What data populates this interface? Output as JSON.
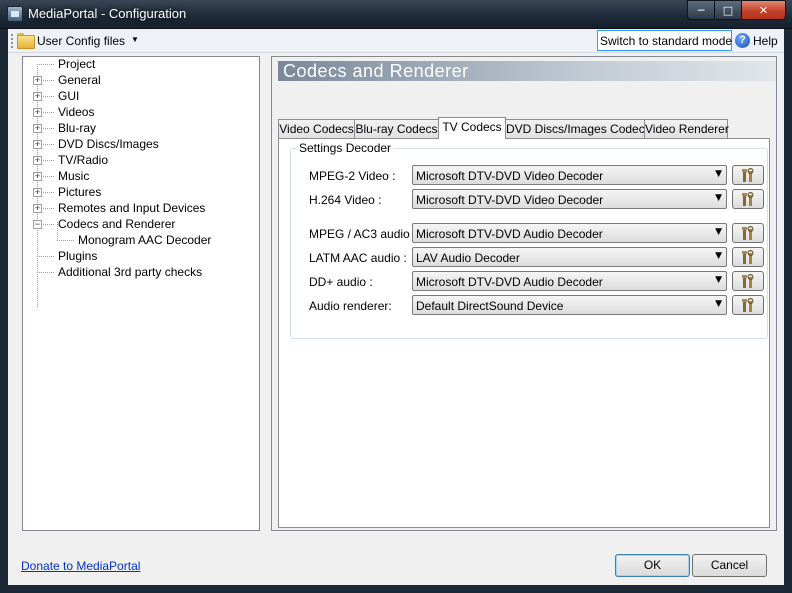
{
  "window": {
    "title": "MediaPortal - Configuration"
  },
  "toolbar": {
    "config_menu_label": "User Config files",
    "switch_label": "Switch to standard mode",
    "help_label": "Help"
  },
  "tree": {
    "items": [
      {
        "label": "Project"
      },
      {
        "label": "General"
      },
      {
        "label": "GUI"
      },
      {
        "label": "Videos"
      },
      {
        "label": "Blu-ray"
      },
      {
        "label": "DVD Discs/Images"
      },
      {
        "label": "TV/Radio"
      },
      {
        "label": "Music"
      },
      {
        "label": "Pictures"
      },
      {
        "label": "Remotes and Input Devices"
      },
      {
        "label": "Codecs and Renderer"
      },
      {
        "label": "Monogram AAC Decoder"
      },
      {
        "label": "Plugins"
      },
      {
        "label": "Additional 3rd party checks"
      }
    ]
  },
  "panel": {
    "title": "Codecs and Renderer",
    "tabs": [
      {
        "label": "Video Codecs"
      },
      {
        "label": "Blu-ray Codecs"
      },
      {
        "label": "TV Codecs"
      },
      {
        "label": "DVD Discs/Images Codecs"
      },
      {
        "label": "Video Renderer"
      }
    ],
    "group_title": "Settings Decoder",
    "rows": [
      {
        "label": "MPEG-2 Video :",
        "value": "Microsoft DTV-DVD Video Decoder"
      },
      {
        "label": "H.264 Video :",
        "value": "Microsoft DTV-DVD Video Decoder"
      },
      {
        "label": "MPEG / AC3 audio :",
        "value": "Microsoft DTV-DVD Audio Decoder"
      },
      {
        "label": "LATM AAC audio :",
        "value": "LAV Audio Decoder"
      },
      {
        "label": "DD+ audio :",
        "value": "Microsoft DTV-DVD Audio Decoder"
      },
      {
        "label": "Audio renderer:",
        "value": "Default DirectSound Device"
      }
    ]
  },
  "footer": {
    "donate_label": "Donate to MediaPortal",
    "ok_label": "OK",
    "cancel_label": "Cancel"
  }
}
